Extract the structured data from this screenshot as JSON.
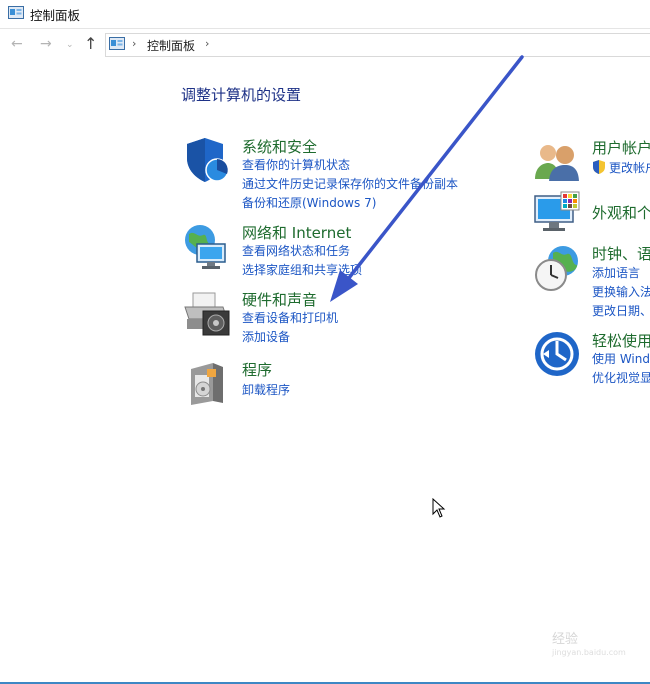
{
  "window": {
    "title": "控制面板"
  },
  "navbar": {
    "back_glyph": "←",
    "forward_glyph": "→",
    "recent_glyph": "⌄",
    "up_glyph": "↑",
    "separator": "›",
    "breadcrumb": "控制面板"
  },
  "main": {
    "heading": "调整计算机的设置",
    "categories": [
      {
        "title": "系统和安全",
        "icon": "shield-icon",
        "links": [
          "查看你的计算机状态",
          "通过文件历史记录保存你的文件备份副本",
          "备份和还原(Windows 7)"
        ]
      },
      {
        "title": "网络和 Internet",
        "icon": "network-icon",
        "links": [
          "查看网络状态和任务",
          "选择家庭组和共享选项"
        ]
      },
      {
        "title": "硬件和声音",
        "icon": "printer-icon",
        "links": [
          "查看设备和打印机",
          "添加设备"
        ]
      },
      {
        "title": "程序",
        "icon": "programs-icon",
        "links": [
          "卸载程序"
        ]
      },
      {
        "title": "用户帐户",
        "icon": "users-icon",
        "links": [
          "更改帐户"
        ]
      },
      {
        "title": "外观和个",
        "icon": "display-icon",
        "links": []
      },
      {
        "title": "时钟、语",
        "icon": "clock-icon",
        "links": [
          "添加语言",
          "更换输入法",
          "更改日期、"
        ]
      },
      {
        "title": "轻松使用",
        "icon": "accessibility-icon",
        "links": [
          "使用 Wind",
          "优化视觉显"
        ]
      }
    ]
  },
  "watermark": {
    "text": "经验",
    "sub": "jingyan.baidu.com"
  },
  "colors": {
    "heading": "#1e3287",
    "category_title": "#1e6b2e",
    "link": "#1c56c4",
    "annotation_arrow": "#3a55c8"
  }
}
